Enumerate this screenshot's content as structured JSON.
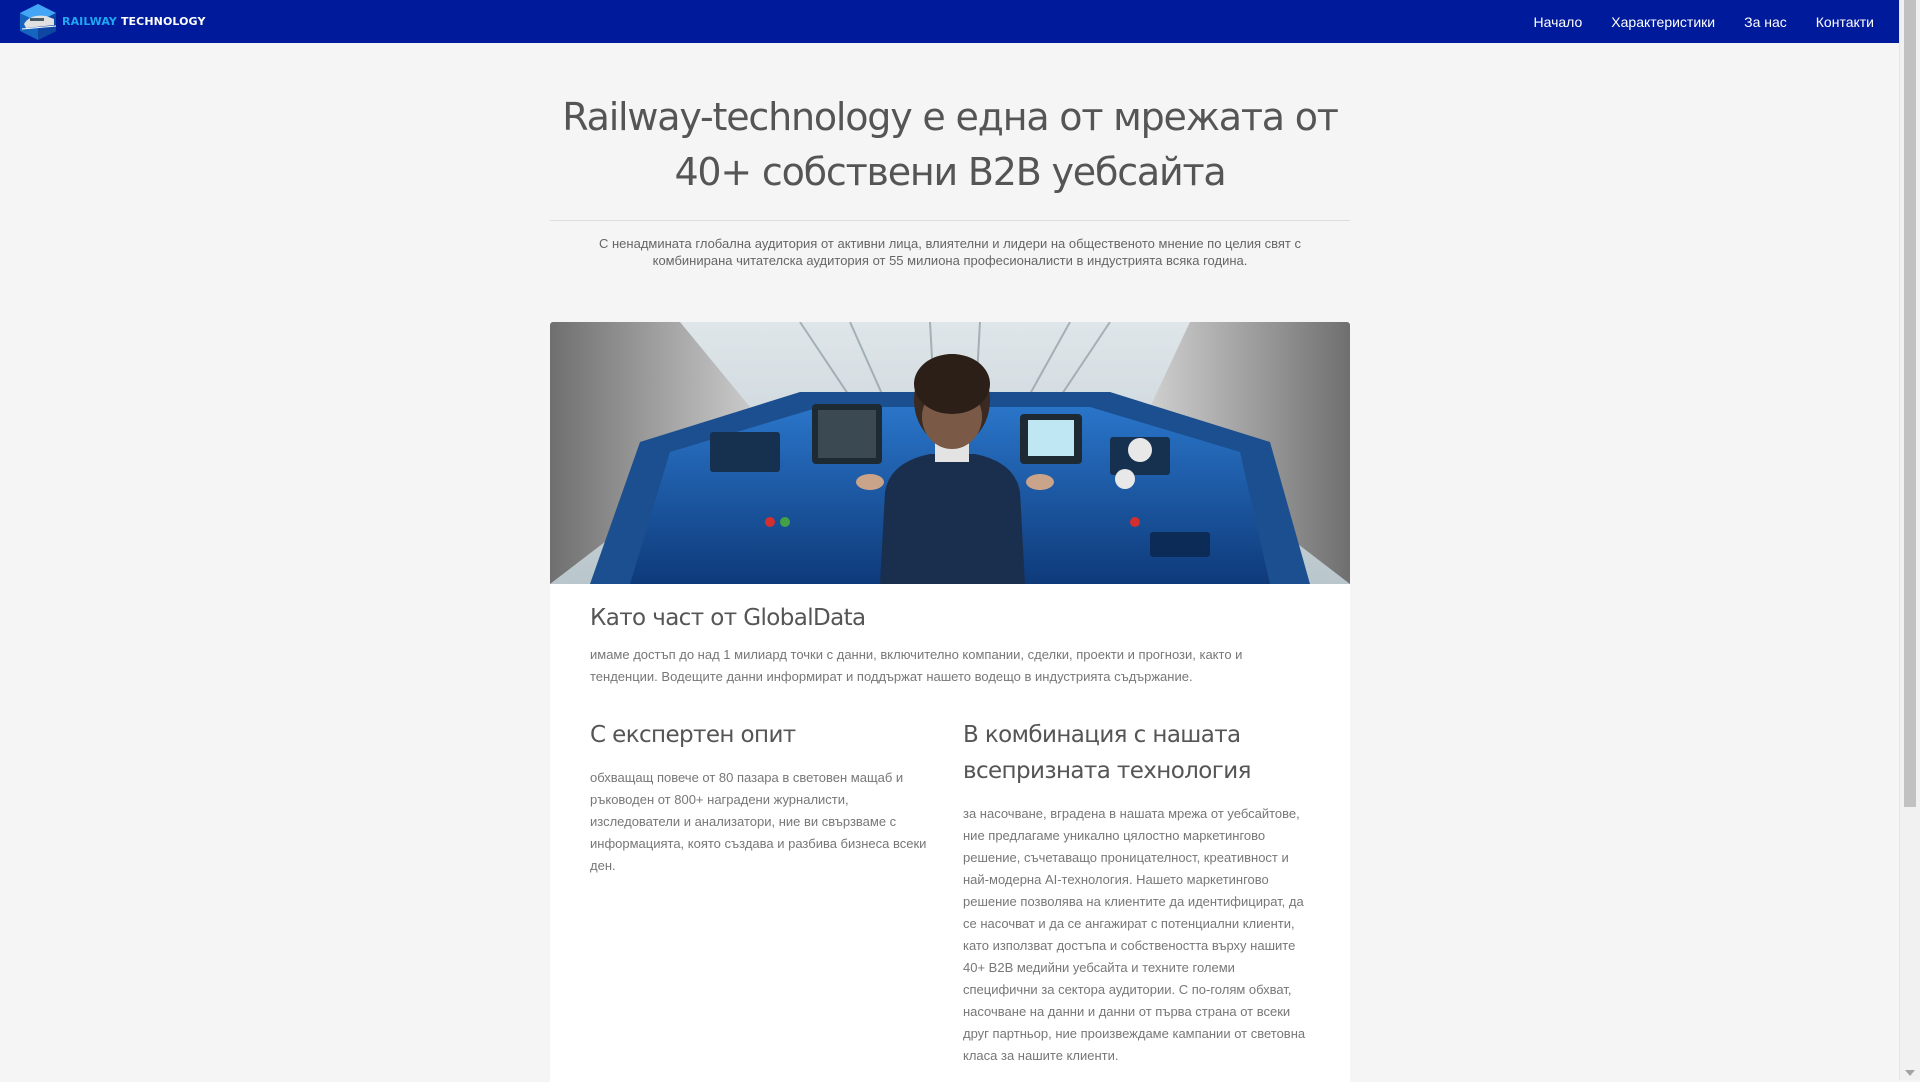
{
  "navbar": {
    "brand_railway": "RAILWAY",
    "brand_technology": "TECHNOLOGY",
    "logo_icon": "train-cube-logo-icon",
    "links": [
      "Начало",
      "Характеристики",
      "За нас",
      "Контакти"
    ],
    "background": "#001a9c",
    "accent": "#1ea7f2"
  },
  "hero": {
    "title": "Railway-technology е една от мрежата от 40+ собствени B2B уебсайта",
    "subtitle": "С ненадмината глобална аудитория от активни лица, влиятелни и лидери на общественото мнение по целия свят с комбинирана читателска аудитория от 55 милиона професионалисти в индустрията всяка година."
  },
  "banner": {
    "image_icon": "train-driver-cabin-photo"
  },
  "sections": [
    {
      "heading": "Като част от GlobalData",
      "text": "имаме достъп до над 1 милиард точки с данни, включително компании, сделки, проекти и прогнози, както и тенденции. Водещите данни информират и поддържат нашето водещо в индустрията съдържание."
    },
    {
      "heading": "С експертен опит",
      "text": "обхващащ повече от 80 пазара в световен мащаб и ръководен от 800+ наградени журналисти, изследователи и анализатори, ние ви свързваме с информацията, която създава и разбива бизнеса всеки ден."
    },
    {
      "heading": "В комбинация с нашата всепризната технология",
      "text": "за насочване, вградена в нашата мрежа от уебсайтове, ние предлагаме уникално цялостно маркетингово решение, съчетаващо проницателност, креативност и най-модерна AI-технология. Нашето маркетингово решение позволява на клиентите да идентифицират, да се насочват и да се ангажират с потенциални клиенти, като използват достъпа и собствеността върху нашите 40+ B2B медийни уебсайта и техните големи специфични за сектора аудитории. С по-голям обхват, насочване на данни и данни от първа страна от всеки друг партньор, ние произвеждаме кампании от световна класа за нашите клиенти."
    }
  ]
}
